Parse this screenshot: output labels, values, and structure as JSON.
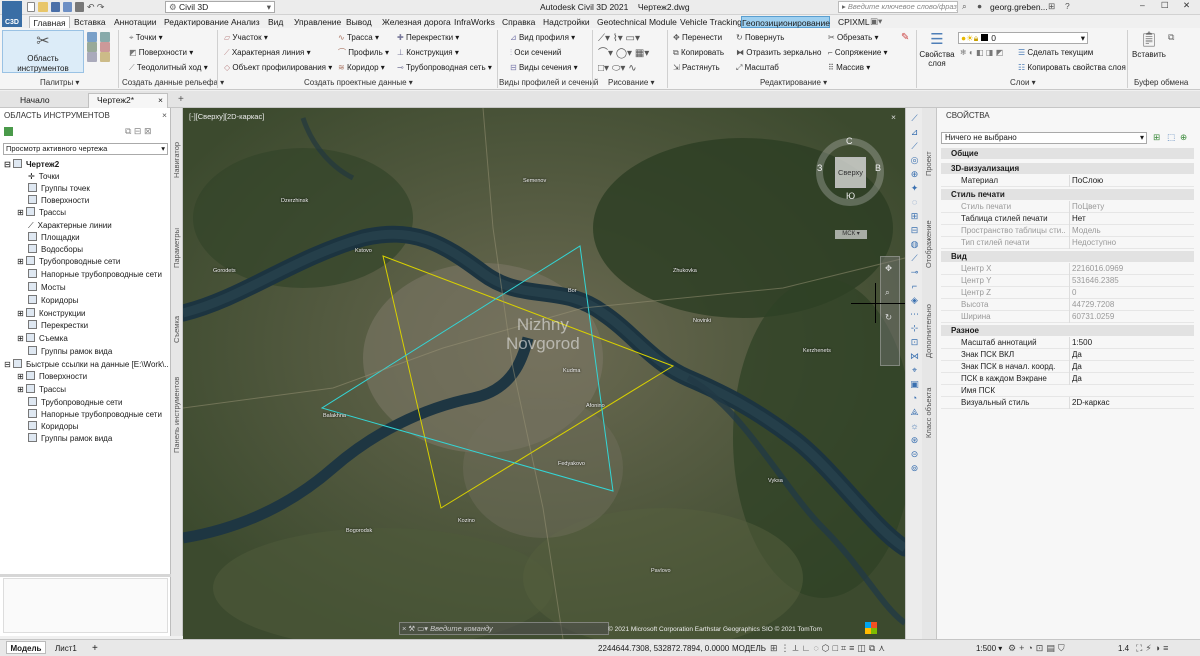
{
  "title": {
    "app_badge": "C3D",
    "workspace": "Civil 3D",
    "app_name": "Autodesk Civil 3D 2021",
    "file_name": "Чертеж2.dwg",
    "search_placeholder": "Введите ключевое слово/фразу",
    "user": "georg.greben..."
  },
  "ribbon_tabs": [
    "Главная",
    "Вставка",
    "Аннотации",
    "Редактирование",
    "Анализ",
    "Вид",
    "Управление",
    "Вывод",
    "Железная дорога",
    "InfraWorks",
    "Справка",
    "Надстройки",
    "Geotechnical Module",
    "Vehicle Tracking",
    "Геопозиционирование",
    "CPIXML"
  ],
  "ribbon": {
    "toolspace_btn": "Область инструментов",
    "palettes": "Палитры",
    "terrain": {
      "items": [
        "Точки",
        "Поверхности",
        "Теодолитный ход"
      ],
      "label": "Создать данные рельефа"
    },
    "design1": [
      "Участок",
      "Характерная линия",
      "Объект профилирования"
    ],
    "design2": [
      "Трасса",
      "Профиль",
      "Коридор"
    ],
    "design3": [
      "Перекрестки",
      "Конструкция",
      "Трубопроводная сеть"
    ],
    "design_label": "Создать проектные данные",
    "profiles": {
      "items": [
        "Вид профиля",
        "Оси сечений",
        "Виды сечения"
      ],
      "label": "Виды профилей и сечений"
    },
    "draw_label": "Рисование",
    "modify1": [
      "Перенести",
      "Копировать",
      "Растянуть"
    ],
    "modify2": [
      "Повернуть",
      "Отразить зеркально",
      "Масштаб"
    ],
    "modify3": [
      "Обрезать",
      "Сопряжение",
      "Массив"
    ],
    "modify_label": "Редактирование",
    "layer_props": "Свойства слоя",
    "layer_value": "0",
    "make_current": "Сделать текущим",
    "copy_layer_props": "Копировать свойства слоя",
    "layers_label": "Слои",
    "paste": "Вставить",
    "clipboard_label": "Буфер обмена"
  },
  "doc_tabs": {
    "start": "Начало",
    "drawing": "Чертеж2*"
  },
  "toolspace": {
    "title": "ОБЛАСТЬ ИНСТРУМЕНТОВ",
    "view_select": "Просмотр активного чертежа",
    "tree_root": "Чертеж2",
    "tree_items": [
      "Точки",
      "Группы точек",
      "Поверхности",
      "Трассы",
      "Характерные линии",
      "Площадки",
      "Водосборы",
      "Трубопроводные сети",
      "Напорные трубопроводные сети",
      "Мосты",
      "Коридоры",
      "Конструкции",
      "Перекрестки",
      "Съемка",
      "Группы рамок вида"
    ],
    "shortcuts_root": "Быстрые ссылки на данные [E:\\Work\\...",
    "shortcut_items": [
      "Поверхности",
      "Трассы",
      "Трубопроводные сети",
      "Напорные трубопроводные сети",
      "Коридоры",
      "Группы рамок вида"
    ],
    "side_tabs": [
      "Навигатор",
      "Параметры",
      "Съемка",
      "Панель инструментов"
    ]
  },
  "viewport": {
    "label": "[-][Сверху][2D-каркас]",
    "city": [
      "Nizhny",
      "Novgorod"
    ],
    "viewcube": {
      "face": "Сверху",
      "north": "С",
      "south": "Ю",
      "east": "В",
      "west": "З",
      "ucs": "МСК"
    },
    "command_placeholder": "Введите команду",
    "copyright": "© 2021 Microsoft Corporation Earthstar Geographics SIO © 2021 TomTom",
    "place_labels": [
      "Kstovo",
      "Bor",
      "Dzerzhinsk",
      "Balakhna",
      "Afonino",
      "Kudma",
      "Fedyakovo",
      "Bogorodsk",
      "Vyksa",
      "Zhukovka",
      "Pavlovo",
      "Novinki",
      "Gorodets",
      "Semenov",
      "Kerzhenets",
      "Kozino"
    ]
  },
  "props": {
    "title": "СВОЙСТВА",
    "selection": "Ничего не выбрано",
    "side_tabs": [
      "Проект",
      "Отображение",
      "Дополнительно",
      "Класс объекта"
    ],
    "cat_general": "Общие",
    "cat_3d": "3D-визуализация",
    "material": [
      "Материал",
      "ПоСлою"
    ],
    "cat_plot": "Стиль печати",
    "plot_rows": [
      [
        "Стиль печати",
        "ПоЦвету"
      ],
      [
        "Таблица стилей печати",
        "Нет"
      ],
      [
        "Пространство таблицы сти...",
        "Модель"
      ],
      [
        "Тип стилей печати",
        "Недоступно"
      ]
    ],
    "cat_view": "Вид",
    "view_rows": [
      [
        "Центр X",
        "2216016.0969"
      ],
      [
        "Центр Y",
        "531646.2385"
      ],
      [
        "Центр Z",
        "0"
      ],
      [
        "Высота",
        "44729.7208"
      ],
      [
        "Ширина",
        "60731.0259"
      ]
    ],
    "cat_misc": "Разное",
    "misc_rows": [
      [
        "Масштаб аннотаций",
        "1:500"
      ],
      [
        "Знак ПСК ВКЛ",
        "Да"
      ],
      [
        "Знак ПСК в начал. коорд.",
        "Да"
      ],
      [
        "ПСК в каждом Вэкране",
        "Да"
      ],
      [
        "Имя ПСК",
        ""
      ],
      [
        "Визуальный стиль",
        "2D-каркас"
      ]
    ]
  },
  "status": {
    "layout_tabs": [
      "Модель",
      "Лист1"
    ],
    "coords": "2244644.7308, 532872.7894, 0.0000",
    "mode": "МОДЕЛЬ",
    "scale": "1:500",
    "zoom": "1.4"
  },
  "colors": {
    "accent": "#2b7bc4",
    "geo_tab": "#9fd0f0",
    "triangle_yellow": "#d8d000",
    "triangle_cyan": "#33d6d6"
  }
}
